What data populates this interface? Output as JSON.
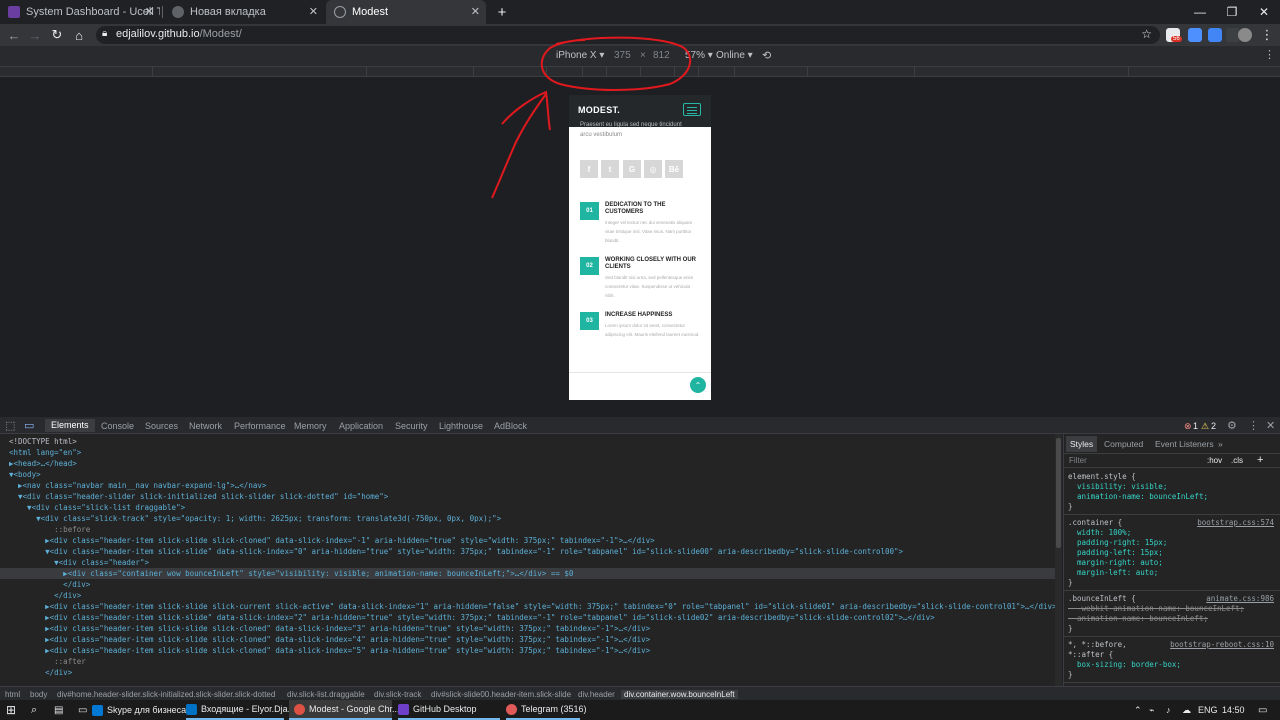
{
  "browser": {
    "tabs": [
      {
        "title": "System Dashboard - Ucell Ticket",
        "favicon_color": "#6a3ea1",
        "active": false
      },
      {
        "title": "Новая вкладка",
        "favicon_color": "#5f6368",
        "active": false
      },
      {
        "title": "Modest",
        "favicon_color": "#9aa0a6",
        "active": true
      }
    ],
    "new_tab_glyph": "+",
    "close_glyph": "✕",
    "window_controls": {
      "minimize": "—",
      "maximize": "❐",
      "close": "✕"
    },
    "url_host": "edjalilov.github.io",
    "url_path": "/Modest/",
    "notification_badge": "56"
  },
  "device_toolbar": {
    "device": "iPhone X ▾",
    "width": "375",
    "times": "×",
    "height": "812",
    "zoom": "57% ▾",
    "network": "Online ▾"
  },
  "phone": {
    "logo": "MODEST.",
    "faded_line1": "Praesent eu ligula sed neque tincidunt",
    "faded_line2": "arcu vestibulum",
    "social": [
      "f",
      "t",
      "G",
      "◎",
      "Bē"
    ],
    "features": [
      {
        "num": "01",
        "title": "DEDICATION TO THE CUSTOMERS",
        "text": "Integer vel lectus nec dui venenatis aliquam vitae tristique nisl. Vitae risus. Nam porttitor blandit."
      },
      {
        "num": "02",
        "title": "WORKING CLOSELY WITH OUR CLIENTS",
        "text": "Sed blandit nisi urna, sed pellentesque enim consectetur vitae. Suspendisse ut vehicula nibh."
      },
      {
        "num": "03",
        "title": "INCREASE HAPPINESS",
        "text": "Lorem ipsum dolor sit amet, consectetur adipiscing elit. Mauris eleifend laoreet euismod."
      }
    ],
    "to_top": "⌃"
  },
  "devtools": {
    "tabs": [
      "Elements",
      "Console",
      "Sources",
      "Network",
      "Performance",
      "Memory",
      "Application",
      "Security",
      "Lighthouse",
      "AdBlock"
    ],
    "errors": "1",
    "warnings": "2",
    "dom_lines": [
      "<!DOCTYPE html>",
      "<html lang=\"en\">",
      "▶<head>…</head>",
      "▼<body>",
      "  ▶<nav class=\"navbar main__nav navbar-expand-lg\">…</nav>",
      "  ▼<div class=\"header-slider slick-initialized slick-slider slick-dotted\" id=\"home\">",
      "    ▼<div class=\"slick-list draggable\">",
      "      ▼<div class=\"slick-track\" style=\"opacity: 1; width: 2625px; transform: translate3d(-750px, 0px, 0px);\">",
      "          ::before",
      "        ▶<div class=\"header-item slick-slide slick-cloned\" data-slick-index=\"-1\" aria-hidden=\"true\" style=\"width: 375px;\" tabindex=\"-1\">…</div>",
      "        ▼<div class=\"header-item slick-slide\" data-slick-index=\"0\" aria-hidden=\"true\" style=\"width: 375px;\" tabindex=\"-1\" role=\"tabpanel\" id=\"slick-slide00\" aria-describedby=\"slick-slide-control00\">",
      "          ▼<div class=\"header\">",
      "            ▶<div class=\"container wow bounceInLeft\" style=\"visibility: visible; animation-name: bounceInLeft;\">…</div> == $0",
      "            </div>",
      "          </div>",
      "        ▶<div class=\"header-item slick-slide slick-current slick-active\" data-slick-index=\"1\" aria-hidden=\"false\" style=\"width: 375px;\" tabindex=\"0\" role=\"tabpanel\" id=\"slick-slide01\" aria-describedby=\"slick-slide-control01\">…</div>",
      "        ▶<div class=\"header-item slick-slide\" data-slick-index=\"2\" aria-hidden=\"true\" style=\"width: 375px;\" tabindex=\"-1\" role=\"tabpanel\" id=\"slick-slide02\" aria-describedby=\"slick-slide-control02\">…</div>",
      "        ▶<div class=\"header-item slick-slide slick-cloned\" data-slick-index=\"3\" aria-hidden=\"true\" style=\"width: 375px;\" tabindex=\"-1\">…</div>",
      "        ▶<div class=\"header-item slick-slide slick-cloned\" data-slick-index=\"4\" aria-hidden=\"true\" style=\"width: 375px;\" tabindex=\"-1\">…</div>",
      "        ▶<div class=\"header-item slick-slide slick-cloned\" data-slick-index=\"5\" aria-hidden=\"true\" style=\"width: 375px;\" tabindex=\"-1\">…</div>",
      "          ::after",
      "        </div>"
    ],
    "styles_tabs": [
      "Styles",
      "Computed",
      "Event Listeners",
      "»"
    ],
    "filter_placeholder": "Filter",
    "filter_hov": ":hov",
    "filter_cls": ".cls",
    "filter_plus": "+",
    "style_lines": [
      {
        "t": "element.style {",
        "src": ""
      },
      {
        "t": "  visibility: visible;",
        "src": ""
      },
      {
        "t": "  animation-name: bounceInLeft;",
        "src": ""
      },
      {
        "t": "}",
        "src": ""
      },
      {
        "t": ".container {",
        "src": "bootstrap.css:574"
      },
      {
        "t": "  width: 100%;",
        "src": ""
      },
      {
        "t": "  padding-right: 15px;",
        "src": ""
      },
      {
        "t": "  padding-left: 15px;",
        "src": ""
      },
      {
        "t": "  margin-right: auto;",
        "src": ""
      },
      {
        "t": "  margin-left: auto;",
        "src": ""
      },
      {
        "t": "}",
        "src": ""
      },
      {
        "t": ".bounceInLeft {",
        "src": "animate.css:986"
      },
      {
        "t": "  -webkit-animation-name: bounceInLeft;",
        "src": "",
        "strike": true
      },
      {
        "t": "  animation-name: bounceInLeft;",
        "src": "",
        "strike": true
      },
      {
        "t": "}",
        "src": ""
      },
      {
        "t": "*, *::before,",
        "src": "bootstrap-reboot.css:10"
      },
      {
        "t": "*::after {",
        "src": ""
      },
      {
        "t": "  box-sizing: border-box;",
        "src": ""
      },
      {
        "t": "}",
        "src": ""
      },
      {
        "t": "*, *::before, *::after {",
        "src": "bootstrap.css:40"
      },
      {
        "t": "  box-sizing: border-box;",
        "src": "",
        "strike": true
      }
    ],
    "breadcrumbs": [
      "html",
      "body",
      "div#home.header-slider.slick-initialized.slick-slider.slick-dotted",
      "div.slick-list.draggable",
      "div.slick-track",
      "div#slick-slide00.header-item.slick-slide",
      "div.header",
      "div.container.wow.bounceInLeft"
    ]
  },
  "taskbar": {
    "apps": [
      {
        "label": "Skype для бизнеса",
        "color": "#0078d4"
      },
      {
        "label": "Входящие - Elyor.Dja...",
        "color": "#0072c6"
      },
      {
        "label": "Modest - Google Chr...",
        "color": "#dd5144",
        "active": true
      },
      {
        "label": "GitHub Desktop",
        "color": "#6e40c9"
      },
      {
        "label": "Telegram (3516)",
        "color": "#e05a5a"
      }
    ],
    "lang": "ENG",
    "time": "14:50"
  },
  "colors": {
    "accent": "#1fb5a0",
    "annotation": "#e0191e",
    "devtools_bg": "#242424"
  }
}
